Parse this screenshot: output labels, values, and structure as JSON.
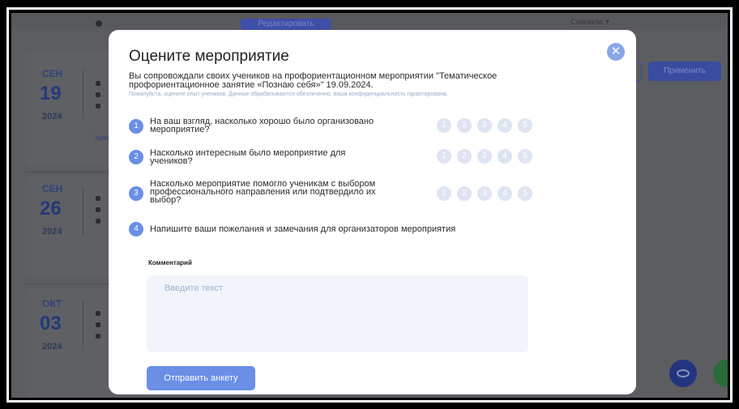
{
  "background": {
    "top_button": "Редактировать",
    "top_select": "Сначала ▾",
    "apply_label": "Применить",
    "link_text": "Запи",
    "events": [
      {
        "month": "СЕН",
        "day": "19",
        "year": "2024"
      },
      {
        "month": "СЕН",
        "day": "26",
        "year": "2024"
      },
      {
        "month": "ОКТ",
        "day": "03",
        "year": "2024"
      }
    ]
  },
  "modal": {
    "title": "Оцените мероприятие",
    "close_symbol": "✕",
    "intro": "Вы сопровождали своих учеников на профориентационном мероприятии \"Тематическое профориентационное занятие «Познаю себя»\" 19.09.2024.",
    "note": "Пожалуйста, оцените опыт учеников. Данные обрабатываются обезличенно, ваша конфиденциальность гарантирована.",
    "scale": [
      "1",
      "2",
      "3",
      "4",
      "5"
    ],
    "questions": [
      {
        "num": "1",
        "text": "На ваш взгляд, насколько хорошо было организовано мероприятие?"
      },
      {
        "num": "2",
        "text": "Насколько интересным было мероприятие для учеников?"
      },
      {
        "num": "3",
        "text": "Насколько мероприятие помогло ученикам с выбором профессионального направления или подтвердило их выбор?"
      },
      {
        "num": "4",
        "text": "Напишите ваши пожелания и замечания для организаторов мероприятия"
      }
    ],
    "comment_label": "Комментарий",
    "comment_placeholder": "Введите текст",
    "comment_value": "",
    "submit_label": "Отправить анкету"
  },
  "colors": {
    "accent": "#6b8fe6",
    "scale_inactive": "#dfe4f2",
    "overlay": "#5c5d61"
  }
}
